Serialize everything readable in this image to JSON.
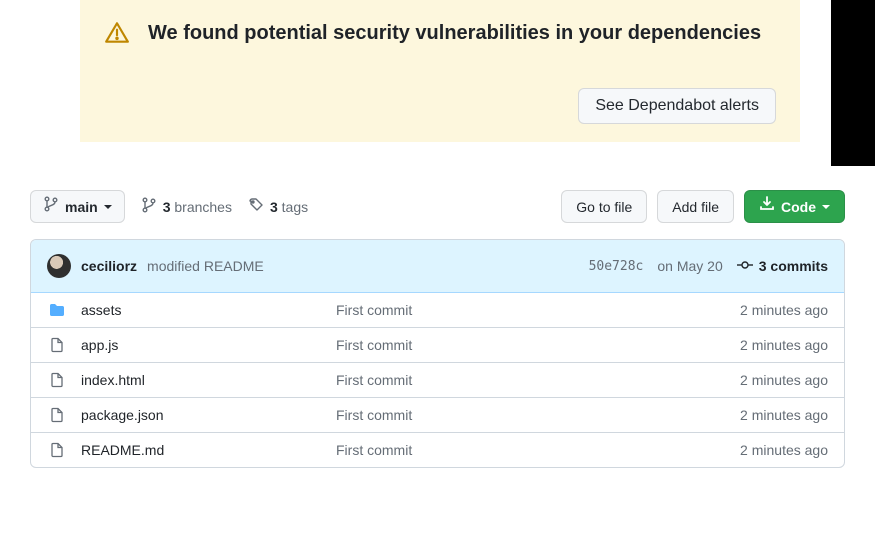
{
  "alert": {
    "title": "We found potential security vulnerabilities in your dependencies",
    "action_label": "See Dependabot alerts"
  },
  "toolbar": {
    "branch_label": "main",
    "branches_count": "3",
    "branches_label": "branches",
    "tags_count": "3",
    "tags_label": "tags",
    "go_to_file": "Go to file",
    "add_file": "Add file",
    "code": "Code"
  },
  "commit": {
    "author": "ceciliorz",
    "message": "modified README",
    "sha": "50e728c",
    "date": "on May 20",
    "commits_count": "3",
    "commits_label": "commits"
  },
  "files": [
    {
      "type": "dir",
      "name": "assets",
      "message": "First commit",
      "time": "2 minutes ago"
    },
    {
      "type": "file",
      "name": "app.js",
      "message": "First commit",
      "time": "2 minutes ago"
    },
    {
      "type": "file",
      "name": "index.html",
      "message": "First commit",
      "time": "2 minutes ago"
    },
    {
      "type": "file",
      "name": "package.json",
      "message": "First commit",
      "time": "2 minutes ago"
    },
    {
      "type": "file",
      "name": "README.md",
      "message": "First commit",
      "time": "2 minutes ago"
    }
  ]
}
